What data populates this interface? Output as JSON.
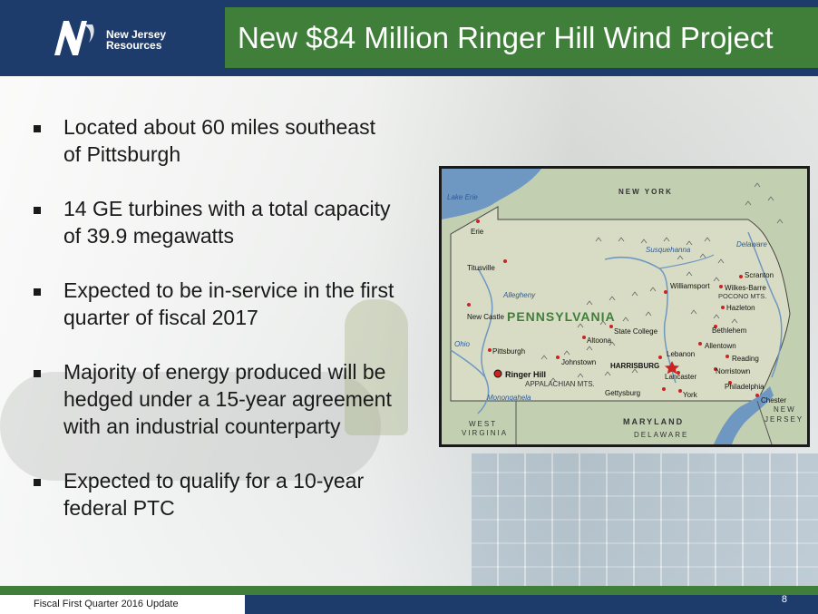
{
  "header": {
    "title": "New $84 Million Ringer Hill Wind Project",
    "logo_line1": "New Jersey",
    "logo_line2": "Resources"
  },
  "bullets": [
    {
      "line1": "Located about 60 miles southeast",
      "line2": "of Pittsburgh"
    },
    {
      "line1": "14 GE turbines with a total capacity",
      "line2": "of 39.9 megawatts"
    },
    {
      "line1": "Expected to be in-service in the first",
      "line2": "quarter of fiscal 2017"
    },
    {
      "line1": "Majority of energy produced will be",
      "line2": "hedged under a 15-year agreement",
      "line3": "with an industrial counterparty"
    },
    {
      "line1": "Expected to qualify for a 10-year",
      "line2": "federal PTC"
    }
  ],
  "map": {
    "state": "PENNSYLVANIA",
    "new_york": "NEW YORK",
    "maryland": "MARYLAND",
    "delaware_state": "DELAWARE",
    "west_virginia_1": "WEST",
    "west_virginia_2": "VIRGINIA",
    "new_jersey_1": "NEW",
    "new_jersey_2": "JERSEY",
    "lake_erie": "Lake Erie",
    "susquehanna": "Susquehanna",
    "delaware_river": "Delaware",
    "allegheny": "Allegheny",
    "ohio": "Ohio",
    "monongahela": "Monongahela",
    "pocono": "POCONO MTS.",
    "appalachian": "APPALACHIAN MTS.",
    "highlight": "Ringer Hill",
    "cities": {
      "erie": "Erie",
      "titusville": "Titusville",
      "new_castle": "New Castle",
      "pittsburgh": "Pittsburgh",
      "altoona": "Altoona",
      "state_college": "State College",
      "johnstown": "Johnstown",
      "harrisburg": "HARRISBURG",
      "gettysburg": "Gettysburg",
      "williamsport": "Williamsport",
      "scranton": "Scranton",
      "wilkes_barre": "Wilkes-Barre",
      "hazleton": "Hazleton",
      "bethlehem": "Bethlehem",
      "allentown": "Allentown",
      "reading": "Reading",
      "norristown": "Norristown",
      "philadelphia": "Philadelphia",
      "lebanon": "Lebanon",
      "lancaster": "Lancaster",
      "york": "York",
      "chester": "Chester"
    }
  },
  "footer": {
    "text": "Fiscal First Quarter 2016 Update",
    "page": "8"
  },
  "colors": {
    "navy": "#1d3c6c",
    "green": "#3f7f3a",
    "map_land": "#c9d4b5",
    "map_water": "#6e97c2",
    "city_marker": "#cc2222"
  }
}
